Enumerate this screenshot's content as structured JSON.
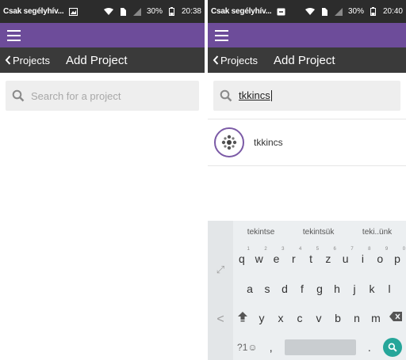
{
  "left": {
    "status": {
      "carrier": "Csak segélyhív...",
      "battery": "30%",
      "time": "20:38"
    },
    "subbar": {
      "back_label": "Projects",
      "title": "Add Project"
    },
    "search": {
      "placeholder": "Search for a project"
    }
  },
  "right": {
    "status": {
      "carrier": "Csak segélyhív...",
      "battery": "30%",
      "time": "20:40"
    },
    "subbar": {
      "back_label": "Projects",
      "title": "Add Project"
    },
    "search": {
      "value": "tkkincs"
    },
    "results": [
      {
        "name": "tkkincs"
      }
    ],
    "keyboard": {
      "suggestions": [
        "tekintse",
        "tekintsük",
        "teki..ünk"
      ],
      "row1": [
        {
          "key": "q",
          "hint": "1"
        },
        {
          "key": "w",
          "hint": "2"
        },
        {
          "key": "e",
          "hint": "3"
        },
        {
          "key": "r",
          "hint": "4"
        },
        {
          "key": "t",
          "hint": "5"
        },
        {
          "key": "z",
          "hint": "6"
        },
        {
          "key": "u",
          "hint": "7"
        },
        {
          "key": "i",
          "hint": "8"
        },
        {
          "key": "o",
          "hint": "9"
        },
        {
          "key": "p",
          "hint": "0"
        }
      ],
      "row2": [
        "a",
        "s",
        "d",
        "f",
        "g",
        "h",
        "j",
        "k",
        "l"
      ],
      "row3": [
        "y",
        "x",
        "c",
        "v",
        "b",
        "n",
        "m"
      ],
      "sym_key": "?1☺",
      "comma": ",",
      "period": ".",
      "side_keys": {
        "expand": "⤢",
        "back": "<"
      }
    }
  },
  "colors": {
    "appbar": "#6d4c9a",
    "subbar": "#3a3a3a",
    "statusbar": "#2c2c2c",
    "search_bg": "#eeeeee",
    "keyboard_bg": "#eceff1",
    "go_key": "#26a69a"
  },
  "icons": [
    "menu-icon",
    "chevron-left-icon",
    "search-icon",
    "wifi-icon",
    "signal-icon",
    "battery-icon",
    "image-icon",
    "shift-icon",
    "backspace-icon"
  ]
}
